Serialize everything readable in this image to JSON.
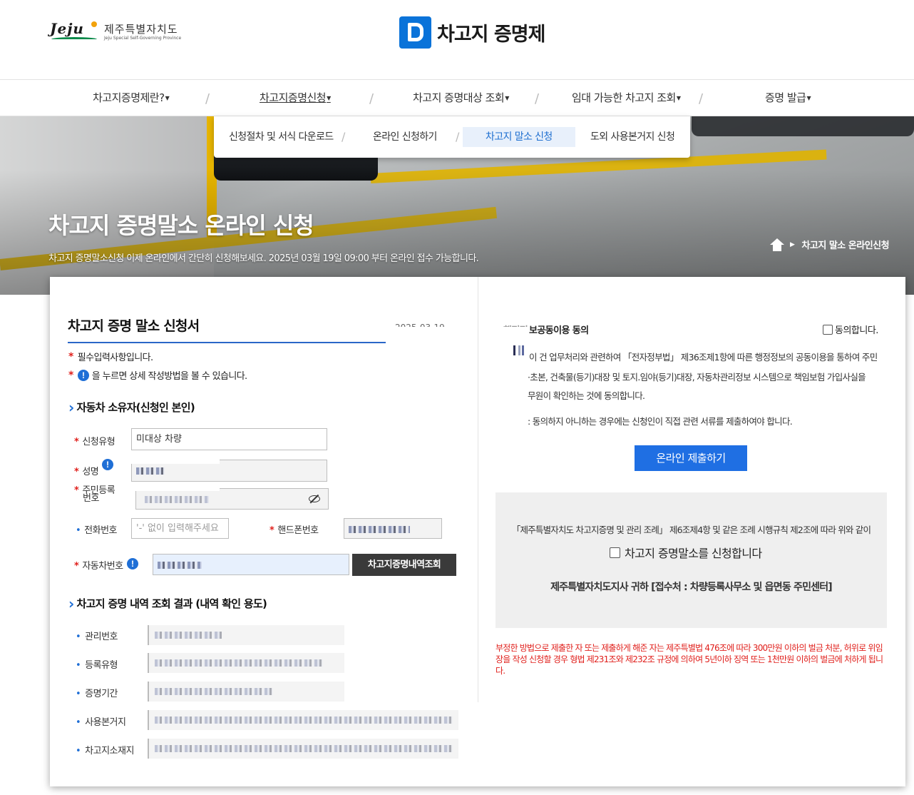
{
  "header": {
    "jeju_logo_text": "Jeju",
    "jeju_name": "제주특별자치도",
    "jeju_sub": "Jeju Special Self-Governing Province",
    "brand_title": "차고지 증명제"
  },
  "nav": {
    "items": [
      {
        "label": "차고지증명제란?"
      },
      {
        "label": "차고지증명신청"
      },
      {
        "label": "차고지 증명대상 조회"
      },
      {
        "label": "임대 가능한 차고지 조회"
      },
      {
        "label": "증명 발급"
      }
    ],
    "active_index": 1,
    "separator": "/"
  },
  "dropdown": {
    "items": [
      {
        "label": "신청절차 및 서식 다운로드"
      },
      {
        "label": "온라인 신청하기"
      },
      {
        "label": "차고지 말소 신청"
      },
      {
        "label": "도외 사용본거지 신청"
      }
    ],
    "active_index": 2
  },
  "hero": {
    "title": "차고지 증명말소 온라인 신청",
    "description": "차고지 증명말소신청 이제 온라인에서 간단히 신청해보세요. 2025년 03월 19일 09:00 부터 온라인 접수 가능합니다.",
    "breadcrumb_current": "차고지 말소 온라인신청"
  },
  "form": {
    "title": "차고지 증명 말소 신청서",
    "date": "2025-03-19",
    "notes": [
      "필수입력사항입니다.",
      "을 누르면 상세 작성방법을 볼 수 있습니다."
    ],
    "section1": "자동차 소유자(신청인 본인)",
    "fields": {
      "apply_type_label": "신청유형",
      "apply_type_value": "미대상 차량",
      "name_label": "성명",
      "rrn_label_1": "주민등록",
      "rrn_label_2": "번호",
      "phone_label": "전화번호",
      "phone_placeholder": "'-' 없이 입력해주세요",
      "mobile_label": "핸드폰번호",
      "car_no_label": "자동차번호"
    },
    "lookup_button": "차고지증명내역조회",
    "section2": "차고지 증명 내역 조회 결과 (내역 확인 용도)",
    "result_labels": [
      "관리번호",
      "등록유형",
      "증명기간",
      "사용본거지",
      "차고지소재지"
    ]
  },
  "consent": {
    "title_prefix": "행정정",
    "title": "보공동이용 동의",
    "agree_label": "동의합니다.",
    "lines": [
      "이 건 업무처리와 관련하여 「전자정부법」 제36조제1항에 따른 행정정보의 공동이용을 통하여 주민",
      "·초본, 건축물(등기)대장 및 토지.임야(등기)대장, 자동차관리정보 시스템으로 책임보험 가입사실을",
      "무원이 확인하는 것에 동의합니다.",
      ": 동의하지 아니하는 경우에는 신청인이 직접 관련 서류를 제출하여야 합니다."
    ],
    "submit_button": "온라인 제출하기"
  },
  "declaration": {
    "text": "「제주특별자치도 차고지증명 및 관리 조례」 제6조제4항 및 같은 조례 시행규칙 제2조에 따라 위와 같이",
    "checkbox_label": "차고지 증명말소를 신청합니다",
    "addressee": "제주특별자치도지사 귀하 [접수처 : 차량등록사무소 및 읍면동 주민센터]"
  },
  "warning": "부정한 방법으로 제출한 자 또는 제출하게 해준 자는 제주특별법 476조에 따라 300만원 이하의 벌금 처분, 허위로 위임장을 작성 신청할 경우 형법 제231조와 제232조 규정에 의하여 5년이하 징역 또는 1천만원 이하의 벌금에 처하게 됩니다.",
  "colors": {
    "brand_blue": "#0a73d9",
    "accent_blue": "#1f6fe3",
    "required_red": "#e0201c",
    "dark_button": "#3a3a3a",
    "hero_yellow": "#e0b400"
  }
}
